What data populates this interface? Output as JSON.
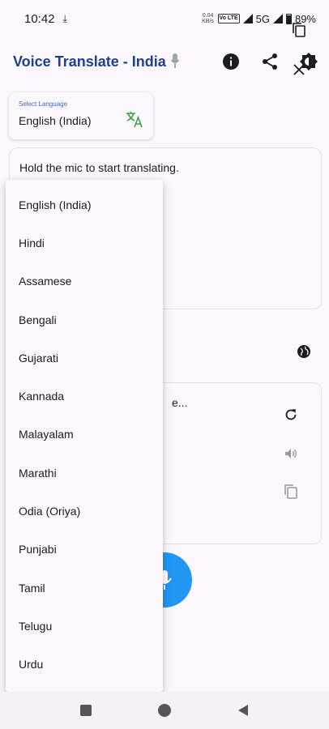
{
  "status_bar": {
    "time": "10:42",
    "net_speed_value": "0.04",
    "net_speed_unit": "KB/s",
    "volte": "Vo LTE",
    "network": "5G",
    "battery": "89%"
  },
  "app_bar": {
    "title": "Voice Translate - India"
  },
  "language_selector": {
    "label": "Select Language",
    "value": "English (India)"
  },
  "input_card": {
    "text": "Hold the mic to start translating."
  },
  "output_card": {
    "text": "e..."
  },
  "language_menu": {
    "options": [
      "English (India)",
      "Hindi",
      "Assamese",
      "Bengali",
      "Gujarati",
      "Kannada",
      "Malayalam",
      "Marathi",
      "Odia (Oriya)",
      "Punjabi",
      "Tamil",
      "Telugu",
      "Urdu"
    ]
  },
  "colors": {
    "accent": "#1f3f93",
    "fab": "#2196f3",
    "translate_icon": "#3aa142",
    "background": "#fcf7fd"
  }
}
